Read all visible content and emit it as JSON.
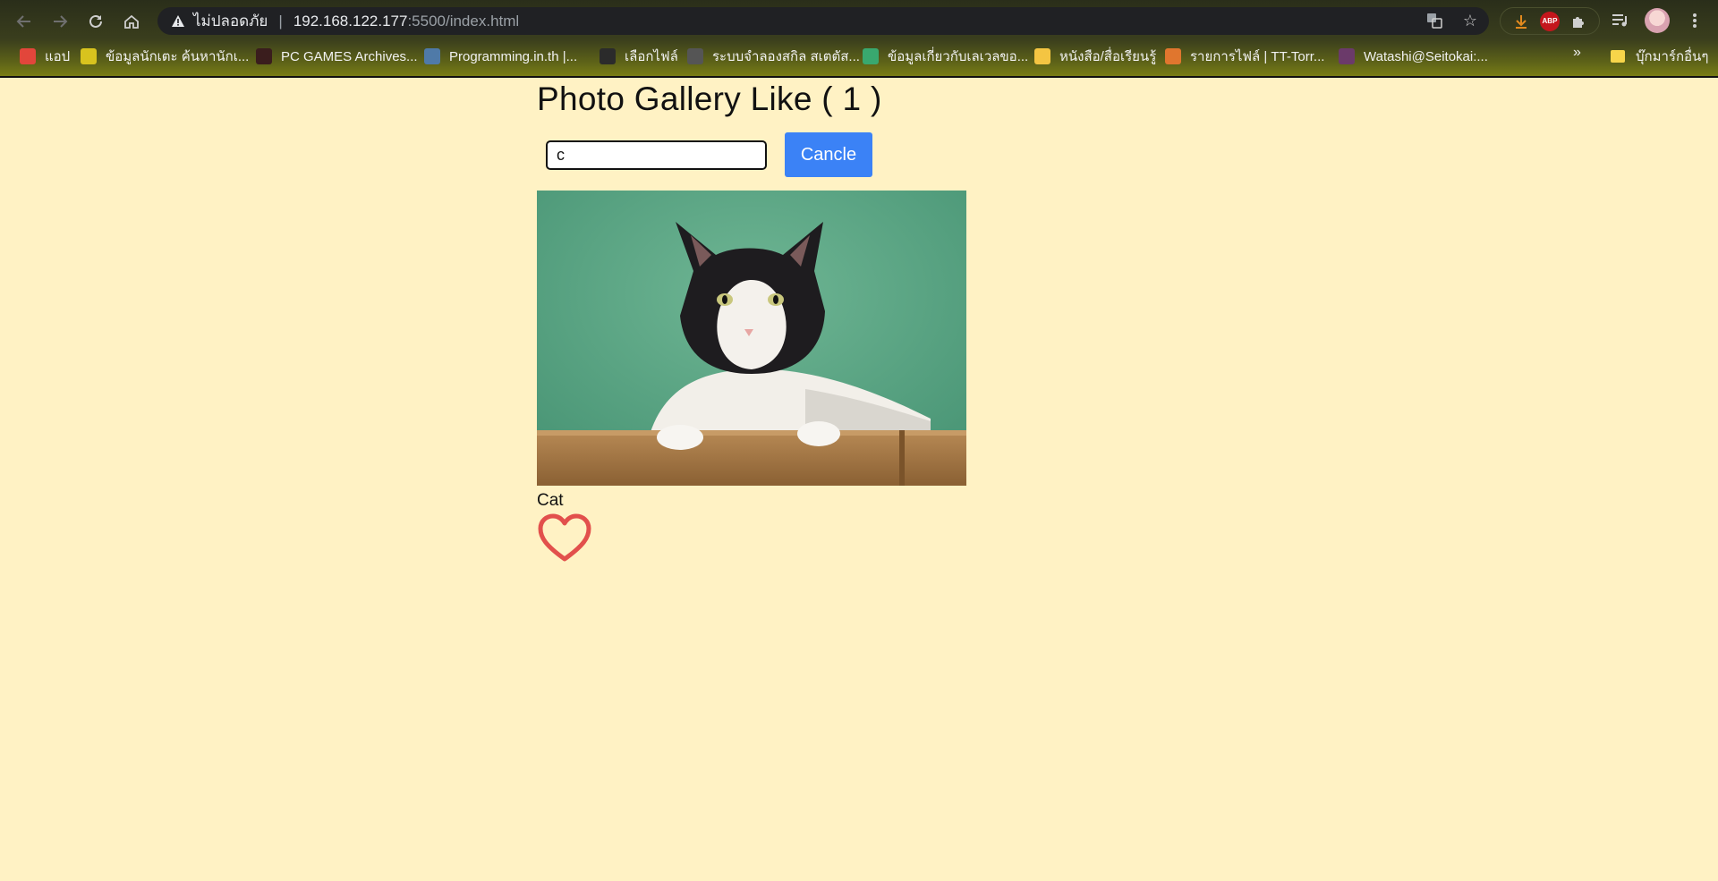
{
  "browser": {
    "security_label": "ไม่ปลอดภัย",
    "url_host": "192.168.122.177",
    "url_path": ":5500/index.html",
    "bookmarks": [
      {
        "label": "แอป",
        "color": "#e2463b"
      },
      {
        "label": "ข้อมูลนักเตะ ค้นหานักเ...",
        "color": "#d8c31e"
      },
      {
        "label": "PC GAMES Archives...",
        "color": "#3a1d1d"
      },
      {
        "label": "Programming.in.th |...",
        "color": "#4f7aa8"
      },
      {
        "label": "เลือกไฟล์",
        "color": "#2b2b2b"
      },
      {
        "label": "ระบบจำลองสกิล สเตตัส...",
        "color": "#555555"
      },
      {
        "label": "ข้อมูลเกี่ยวกับเลเวลขอ...",
        "color": "#39a86f"
      },
      {
        "label": "หนังสือ/สื่อเรียนรู้",
        "color": "#f4c542"
      },
      {
        "label": "รายการไฟล์ | TT-Torr...",
        "color": "#e0762e"
      },
      {
        "label": "Watashi@Seitokai:...",
        "color": "#6b3a6a"
      }
    ],
    "more_label": "»",
    "other_bookmarks": "บุ๊กมาร์กอื่นๆ",
    "extensions": {
      "abp_label": "ABP"
    }
  },
  "page": {
    "title": "Photo Gallery Like ( 1 )",
    "search_value": "c",
    "cancel_label": "Cancle",
    "card": {
      "caption": "Cat",
      "liked": false,
      "heart_color": "#e2504c"
    }
  }
}
